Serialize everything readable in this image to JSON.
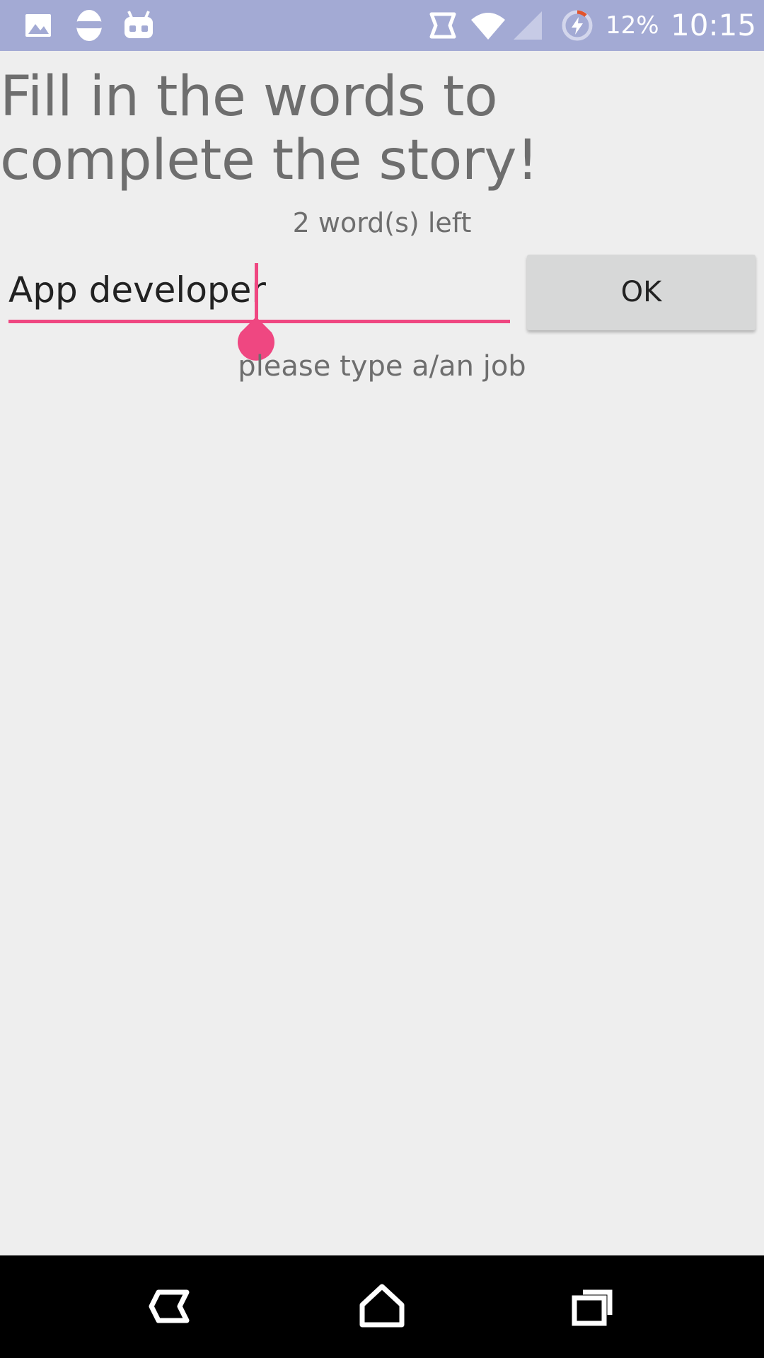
{
  "status_bar": {
    "battery_percent": "12%",
    "time": "10:15",
    "icons": [
      "image-icon",
      "cyanogen-icon",
      "android-debug-icon",
      "nfc-icon",
      "wifi-icon",
      "signal-icon",
      "battery-charging-icon"
    ],
    "battery_accent": "#e2532b"
  },
  "main": {
    "title": "Fill in the words to complete the story!",
    "words_left": "2 word(s) left",
    "input_value": "App developer",
    "ok_label": "OK",
    "hint": "please type a/an job"
  },
  "colors": {
    "status_bar": "#a3aad4",
    "accent": "#ef4781",
    "background": "#eeeeee",
    "button": "#d7d8d8"
  },
  "nav_bar": {
    "icons": [
      "back-icon",
      "home-icon",
      "recents-icon"
    ]
  }
}
